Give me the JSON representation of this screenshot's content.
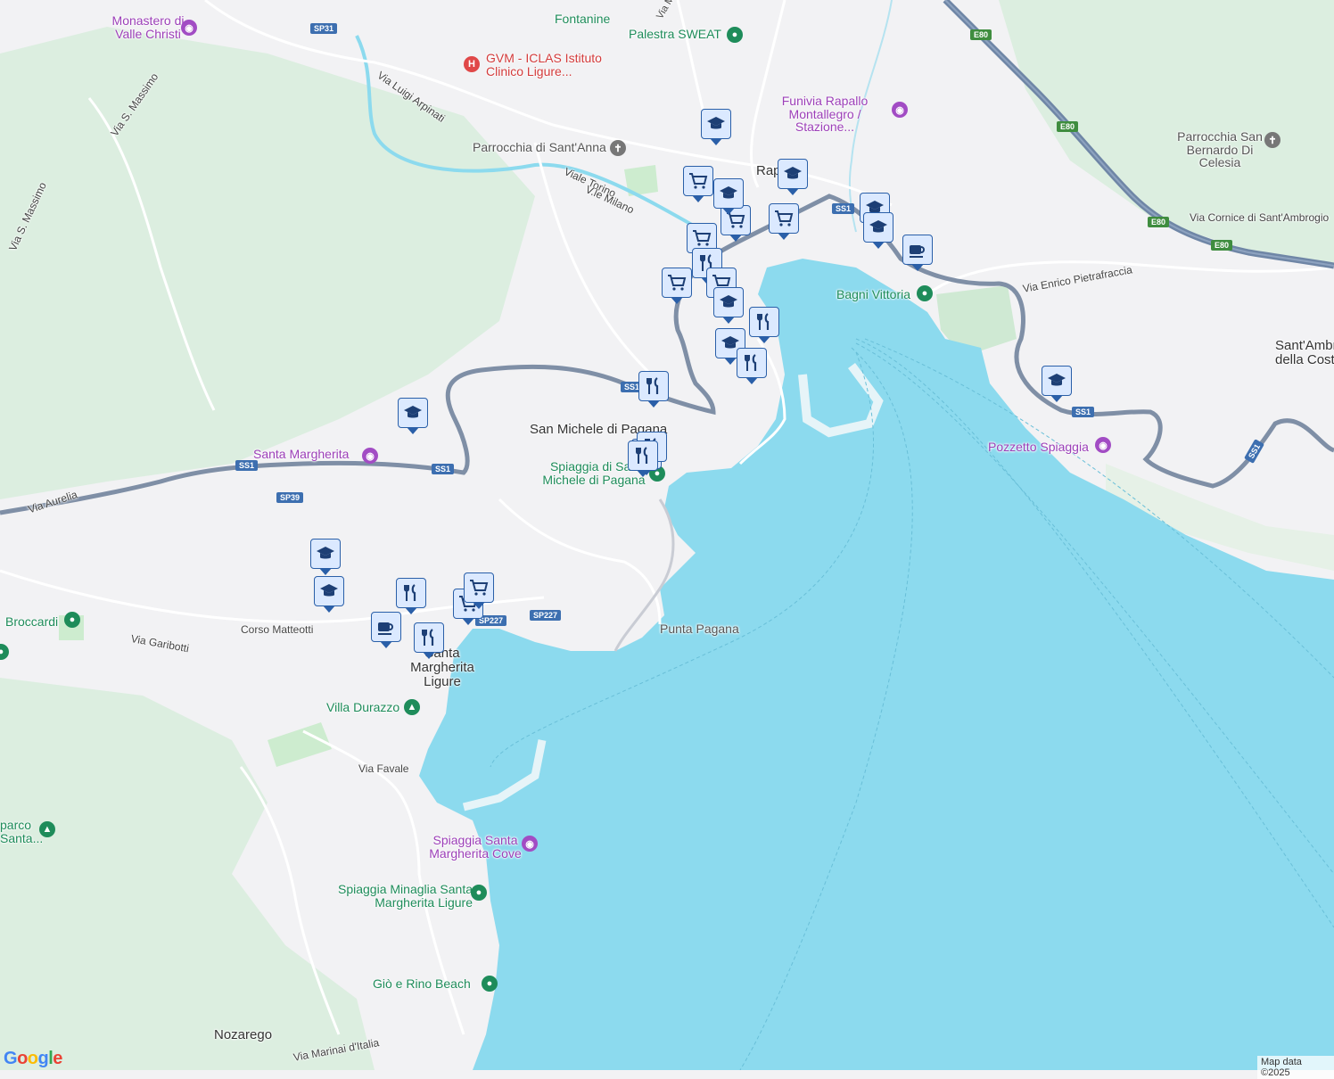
{
  "map": {
    "colors": {
      "land": "#f2f2f4",
      "water": "#8cdaee",
      "park": "#cdeccf",
      "forest": "#dceee0",
      "highway": "#6f86a6",
      "marker_bg": "#dbe9ff",
      "marker_border": "#2a5fa8"
    },
    "places": {
      "rapallo": "Rapallo",
      "san_michele": "San Michele di Pagana",
      "santa_margherita": "Santa Margherita Ligure",
      "nozarego": "Nozarego",
      "sant_ambrogio": "Sant'Ambrogio della Costa"
    },
    "roads": {
      "via_luigi_arpinati": "Via Luigi Arpinati",
      "viale_torino": "Viale Torino",
      "vle_milano": "V.le Milano",
      "via_s_massimo_1": "Via S. Massimo",
      "via_s_massimo_2": "Via S. Massimo",
      "via_aurelia": "Via Aurelia",
      "via_garibotti": "Via Garibotti",
      "corso_matteotti": "Corso Matteotti",
      "via_favale": "Via Favale",
      "via_marinai": "Via Marinai d'Italia",
      "via_enrico": "Via Enrico Pietrafraccia",
      "via_cornice": "Via Cornice di Sant'Ambrogio",
      "via_maggiaro": "Via Maggiaro"
    },
    "shields": {
      "sp31": "SP31",
      "e80_a": "E80",
      "e80_b": "E80",
      "e80_c": "E80",
      "e80_d": "E80",
      "ss1_a": "SS1",
      "ss1_b": "SS1",
      "ss1_c": "SS1",
      "ss1_d": "SS1",
      "ss1_e": "SS1",
      "ss1_f": "SS1",
      "sp39": "SP39",
      "sp227_a": "SP227",
      "sp227_b": "SP227"
    },
    "pois": {
      "monastero": "Monastero di Valle Christi",
      "gvm": "GVM - ICLAS Istituto Clinico Ligure...",
      "fontanine": "Fontanine",
      "palestra": "Palestra SWEAT",
      "funivia": "Funivia Rapallo Montallegro / Stazione...",
      "parrocchia_anna": "Parrocchia di Sant'Anna",
      "parrocchia_bernardo": "Parrocchia San Bernardo Di Celesia",
      "bagni_vittoria": "Bagni Vittoria",
      "pozzetto": "Pozzetto Spiaggia",
      "santa_margherita_poi": "Santa Margherita",
      "spiaggia_san_michele": "Spiaggia di San Michele di Pagana",
      "punta_pagana": "Punta Pagana",
      "broccardi": "Broccardi",
      "villa_durazzo": "Villa Durazzo",
      "parco_santa": "parco Santa...",
      "spiaggia_cove": "Spiaggia Santa Margherita Cove",
      "spiaggia_minaglia": "Spiaggia Minaglia Santa Margherita Ligure",
      "gio_rino": "Giò e Rino Beach"
    },
    "markers": [
      {
        "icon": "school"
      },
      {
        "icon": "school"
      },
      {
        "icon": "cafe"
      },
      {
        "icon": "restaurant"
      },
      {
        "icon": "shop"
      },
      {
        "icon": "school"
      },
      {
        "icon": "shop"
      },
      {
        "icon": "shop"
      },
      {
        "icon": "shop"
      },
      {
        "icon": "restaurant"
      },
      {
        "icon": "shop"
      },
      {
        "icon": "shop"
      },
      {
        "icon": "school"
      },
      {
        "icon": "restaurant"
      },
      {
        "icon": "school"
      },
      {
        "icon": "restaurant"
      },
      {
        "icon": "restaurant"
      },
      {
        "icon": "restaurant"
      },
      {
        "icon": "restaurant"
      },
      {
        "icon": "school"
      },
      {
        "icon": "school"
      },
      {
        "icon": "school"
      },
      {
        "icon": "school"
      },
      {
        "icon": "school"
      },
      {
        "icon": "restaurant"
      },
      {
        "icon": "shop"
      },
      {
        "icon": "shop"
      },
      {
        "icon": "cafe"
      },
      {
        "icon": "restaurant"
      },
      {
        "icon": "school"
      }
    ],
    "google_logo": "Google",
    "attribution": "Map data ©2025"
  }
}
